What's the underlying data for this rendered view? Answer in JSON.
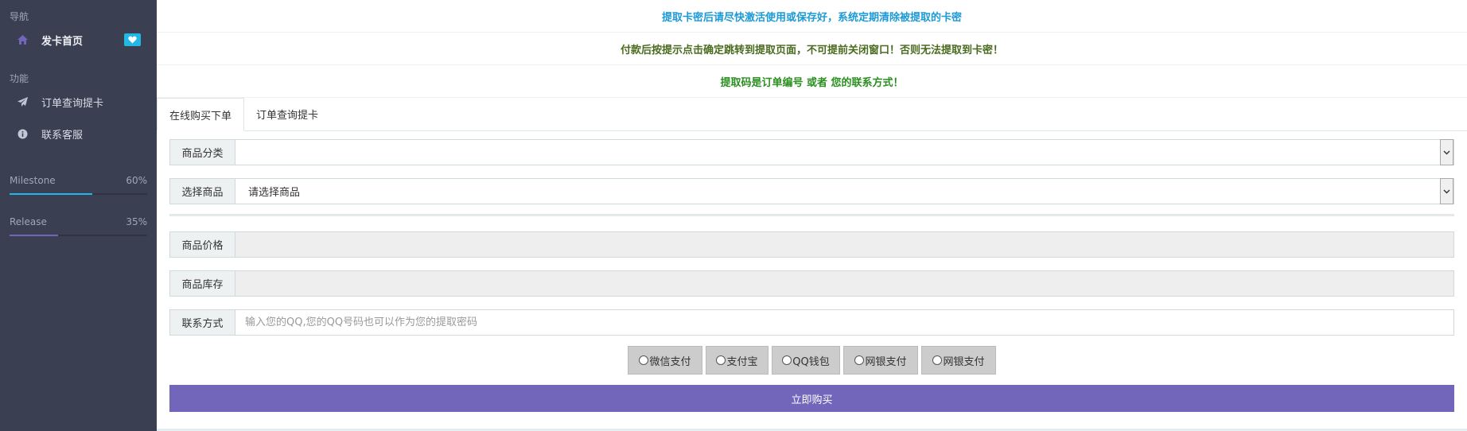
{
  "sidebar": {
    "nav_header": "导航",
    "home": {
      "label": "发卡首页",
      "icon": "home-icon"
    },
    "func_header": "功能",
    "items": [
      {
        "label": "订单查询提卡",
        "icon": "paper-plane-icon"
      },
      {
        "label": "联系客服",
        "icon": "info-circle-icon"
      }
    ],
    "progress": [
      {
        "label": "Milestone",
        "value_text": "60%",
        "value": 0.6,
        "color": "#23b7e5"
      },
      {
        "label": "Release",
        "value_text": "35%",
        "value": 0.35,
        "color": "#7266ba"
      }
    ]
  },
  "notices": [
    {
      "text": "提取卡密后请尽快激活使用或保存好，系统定期清除被提取的卡密",
      "color": "#1b9ad6"
    },
    {
      "text": "付款后按提示点击确定跳转到提取页面，不可提前关闭窗口！否则无法提取到卡密！",
      "color": "#4a6b1f"
    },
    {
      "text": "提取码是订单编号 或者 您的联系方式！",
      "color": "#2a8f1e"
    }
  ],
  "tabs": [
    {
      "label": "在线购买下单"
    },
    {
      "label": "订单查询提卡"
    }
  ],
  "form": {
    "category_label": "商品分类",
    "category_value": "",
    "product_label": "选择商品",
    "product_value": "请选择商品",
    "price_label": "商品价格",
    "price_value": "",
    "stock_label": "商品库存",
    "stock_value": "",
    "contact_label": "联系方式",
    "contact_placeholder": "输入您的QQ,您的QQ号码也可以作为您的提取密码"
  },
  "payment_options": [
    "微信支付",
    "支付宝",
    "QQ钱包",
    "网银支付",
    "网银支付"
  ],
  "buy_button": "立即购买",
  "colors": {
    "sidebar_bg": "#3a3f51",
    "accent": "#7266ba",
    "info": "#23b7e5"
  }
}
